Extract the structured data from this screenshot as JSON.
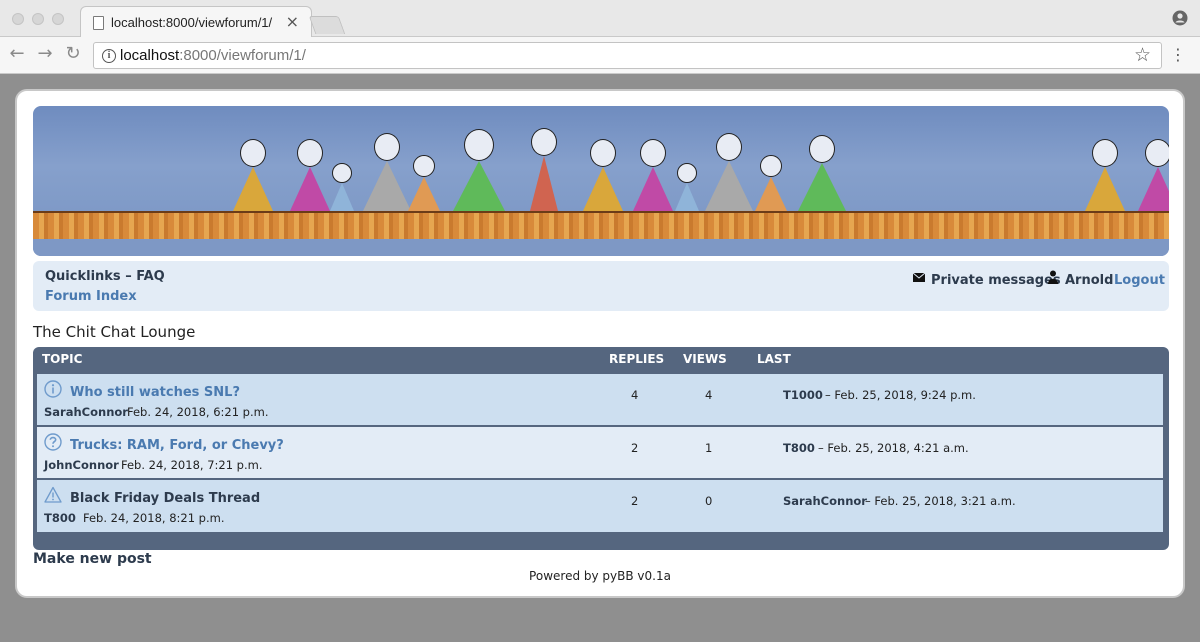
{
  "browser": {
    "tab_title": "localhost:8000/viewforum/1/",
    "tab_close": "×",
    "url_host": "localhost",
    "url_rest": ":8000/viewforum/1/",
    "back_icon": "←",
    "forward_icon": "→",
    "reload_icon": "↻",
    "star_icon": "☆",
    "menu_icon": "⋮"
  },
  "nav": {
    "quicklinks": "Quicklinks – FAQ",
    "forum_index": "Forum Index",
    "private_messages": "Private messages",
    "username": "Arnold",
    "logout": "Logout"
  },
  "forum": {
    "title": "The Chit Chat Lounge",
    "headers": {
      "topic": "TOPIC",
      "replies": "REPLIES",
      "views": "VIEWS",
      "last": "LAST"
    },
    "topics": [
      {
        "icon": "info-icon",
        "title": "Who still watches SNL?",
        "author": "SarahConnor",
        "date": "Feb. 24, 2018, 6:21 p.m.",
        "replies": "4",
        "views": "4",
        "last_user": "T1000",
        "last_date": "– Feb. 25, 2018, 9:24 p.m."
      },
      {
        "icon": "question-icon",
        "title": "Trucks: RAM, Ford, or Chevy?",
        "author": "JohnConnor",
        "date": "Feb. 24, 2018, 7:21 p.m.",
        "replies": "2",
        "views": "1",
        "last_user": "T800",
        "last_date": "– Feb. 25, 2018, 4:21 a.m."
      },
      {
        "icon": "warning-icon",
        "title": "Black Friday Deals Thread",
        "author": "T800",
        "date": "Feb. 24, 2018, 8:21 p.m.",
        "replies": "2",
        "views": "0",
        "last_user": "SarahConnor",
        "last_date": "– Feb. 25, 2018, 3:21 a.m."
      }
    ]
  },
  "footer": {
    "new_post": "Make new post",
    "powered_by": "Powered by pyBB v0.1a"
  },
  "colors": {
    "accent_link": "#4a7ab0",
    "table_header": "#55667f",
    "row_alt_a": "#cddff0",
    "row_alt_b": "#e3ecf6"
  }
}
